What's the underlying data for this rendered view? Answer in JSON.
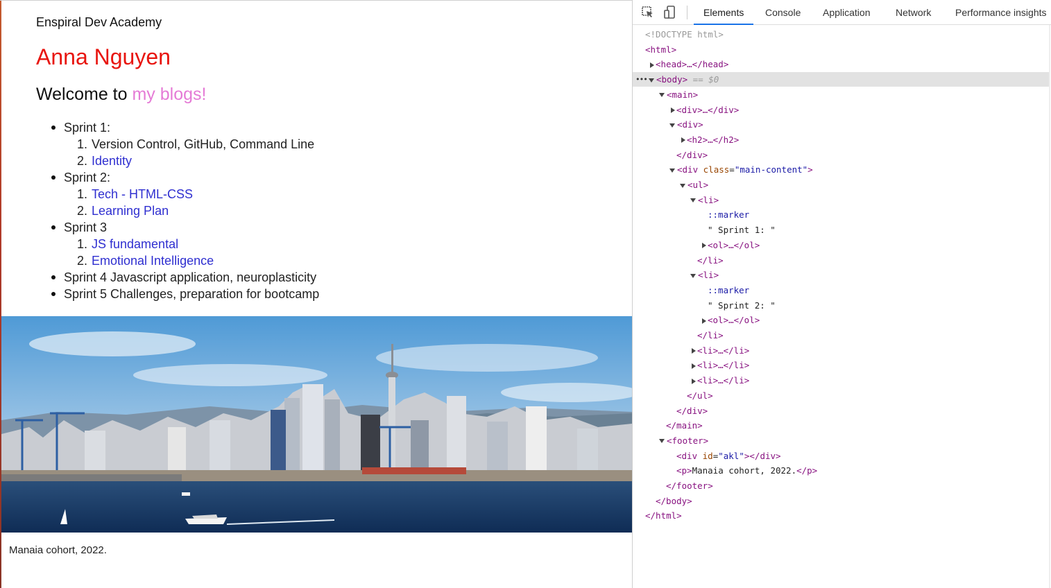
{
  "page": {
    "site_name": "Enspiral Dev Academy",
    "author": "Anna Nguyen",
    "welcome_prefix": "Welcome to ",
    "welcome_highlight": "my blogs!",
    "sprints": [
      {
        "label": "Sprint 1:",
        "items": [
          {
            "num": "1.",
            "text": "Version Control, GitHub, Command Line",
            "link": false
          },
          {
            "num": "2.",
            "text": "Identity",
            "link": true
          }
        ]
      },
      {
        "label": "Sprint 2:",
        "items": [
          {
            "num": "1.",
            "text": "Tech - HTML-CSS",
            "link": true
          },
          {
            "num": "2.",
            "text": "Learning Plan",
            "link": true
          }
        ]
      },
      {
        "label": "Sprint 3",
        "items": [
          {
            "num": "1.",
            "text": "JS fundamental",
            "link": true
          },
          {
            "num": "2.",
            "text": "Emotional Intelligence",
            "link": true
          }
        ]
      },
      {
        "label": "Sprint 4 Javascript application, neuroplasticity",
        "items": []
      },
      {
        "label": "Sprint 5 Challenges, preparation for bootcamp",
        "items": []
      }
    ],
    "caption": "Manaia cohort, 2022."
  },
  "devtools": {
    "tabs": [
      "Elements",
      "Console",
      "Application",
      "Network",
      "Performance insights"
    ],
    "active_tab": "Elements",
    "icons": [
      "inspect-icon",
      "device-toggle-icon"
    ],
    "tree": [
      {
        "indent": 0,
        "kind": "doctype",
        "text": "<!DOCTYPE html>"
      },
      {
        "indent": 0,
        "kind": "tag",
        "text": "<html>"
      },
      {
        "indent": 1,
        "kind": "tag",
        "toggle": "right",
        "text": "<head>…</head>"
      },
      {
        "indent": 1,
        "kind": "tag",
        "toggle": "down",
        "text": "<body>",
        "suffix": " == $0",
        "selected": true
      },
      {
        "indent": 2,
        "kind": "tag",
        "toggle": "down",
        "text": "<main>"
      },
      {
        "indent": 3,
        "kind": "tag",
        "toggle": "right",
        "text": "<div>…</div>"
      },
      {
        "indent": 3,
        "kind": "tag",
        "toggle": "down",
        "text": "<div>"
      },
      {
        "indent": 4,
        "kind": "tag",
        "toggle": "right",
        "text": "<h2>…</h2>"
      },
      {
        "indent": 3,
        "kind": "tag",
        "text": "</div>"
      },
      {
        "indent": 3,
        "kind": "tag",
        "toggle": "down",
        "tagname": "div",
        "attr_name": "class",
        "attr_value": "\"main-content\""
      },
      {
        "indent": 4,
        "kind": "tag",
        "toggle": "down",
        "text": "<ul>"
      },
      {
        "indent": 5,
        "kind": "tag",
        "toggle": "down",
        "text": "<li>"
      },
      {
        "indent": 6,
        "kind": "pseudo",
        "text": "::marker"
      },
      {
        "indent": 6,
        "kind": "text",
        "text": "\" Sprint 1: \""
      },
      {
        "indent": 6,
        "kind": "tag",
        "toggle": "right",
        "text": "<ol>…</ol>"
      },
      {
        "indent": 5,
        "kind": "tag",
        "text": "</li>"
      },
      {
        "indent": 5,
        "kind": "tag",
        "toggle": "down",
        "text": "<li>"
      },
      {
        "indent": 6,
        "kind": "pseudo",
        "text": "::marker"
      },
      {
        "indent": 6,
        "kind": "text",
        "text": "\" Sprint 2: \""
      },
      {
        "indent": 6,
        "kind": "tag",
        "toggle": "right",
        "text": "<ol>…</ol>"
      },
      {
        "indent": 5,
        "kind": "tag",
        "text": "</li>"
      },
      {
        "indent": 5,
        "kind": "tag",
        "toggle": "right",
        "text": "<li>…</li>"
      },
      {
        "indent": 5,
        "kind": "tag",
        "toggle": "right",
        "text": "<li>…</li>"
      },
      {
        "indent": 5,
        "kind": "tag",
        "toggle": "right",
        "text": "<li>…</li>"
      },
      {
        "indent": 4,
        "kind": "tag",
        "text": "</ul>"
      },
      {
        "indent": 3,
        "kind": "tag",
        "text": "</div>"
      },
      {
        "indent": 2,
        "kind": "tag",
        "text": "</main>"
      },
      {
        "indent": 2,
        "kind": "tag",
        "toggle": "down",
        "text": "<footer>"
      },
      {
        "indent": 3,
        "kind": "tag",
        "tagname": "div",
        "attr_name": "id",
        "attr_value": "\"akl\"",
        "closing": "</div>"
      },
      {
        "indent": 3,
        "kind": "mixed",
        "open": "<p>",
        "inner": "Manaia cohort, 2022.",
        "close": "</p>"
      },
      {
        "indent": 2,
        "kind": "tag",
        "text": "</footer>"
      },
      {
        "indent": 1,
        "kind": "tag",
        "text": "</body>"
      },
      {
        "indent": 0,
        "kind": "tag",
        "text": "</html>"
      }
    ]
  },
  "colors": {
    "author": "#e8150f",
    "highlight": "#e57bd6",
    "link": "#2f2fd0",
    "devtools_accent": "#1a73e8"
  }
}
